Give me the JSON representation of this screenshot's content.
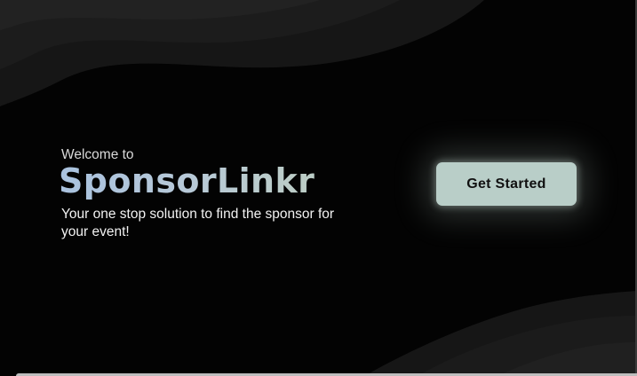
{
  "hero": {
    "welcome": "Welcome to",
    "brand": "SponsorLinkr",
    "tagline": "Your one stop solution to find the sponsor for your event!"
  },
  "cta": {
    "label": "Get Started"
  },
  "colors": {
    "background": "#030303",
    "wave_dark": "#141414",
    "wave_mid": "#1b1b1b",
    "wave_light": "#222222",
    "button": "#b9cec8",
    "brand_gradient_start": "#a9c2df",
    "brand_gradient_end": "#b4c9c0"
  }
}
